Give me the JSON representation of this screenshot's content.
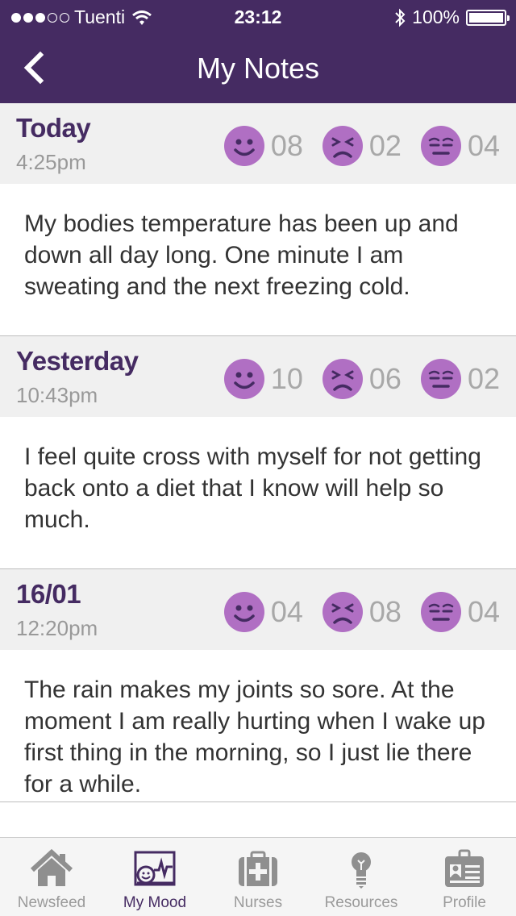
{
  "status": {
    "carrier": "Tuenti",
    "time": "23:12",
    "battery": "100%",
    "battery_level": 1.0
  },
  "nav": {
    "title": "My Notes",
    "back_icon": "chevron-left-icon"
  },
  "notes": [
    {
      "day": "Today",
      "time": "4:25pm",
      "moods": {
        "happy": "08",
        "upset": "02",
        "tired": "04"
      },
      "text": "My bodies temperature has been up and down all day long.  One minute I am sweating and the next freezing cold."
    },
    {
      "day": "Yesterday",
      "time": "10:43pm",
      "moods": {
        "happy": "10",
        "upset": "06",
        "tired": "02"
      },
      "text": "I feel quite cross with myself for not getting back onto a diet that I know will help so much."
    },
    {
      "day": "16/01",
      "time": "12:20pm",
      "moods": {
        "happy": "04",
        "upset": "08",
        "tired": "04"
      },
      "text": "The rain makes my joints so sore.  At the moment I am really hurting when I wake up first thing in the morning, so I just lie there for a while."
    }
  ],
  "tabs": [
    {
      "label": "Newsfeed",
      "icon": "house-icon",
      "active": false
    },
    {
      "label": "My Mood",
      "icon": "mood-chart-icon",
      "active": true
    },
    {
      "label": "Nurses",
      "icon": "medical-kit-icon",
      "active": false
    },
    {
      "label": "Resources",
      "icon": "lightbulb-icon",
      "active": false
    },
    {
      "label": "Profile",
      "icon": "id-card-icon",
      "active": false
    }
  ],
  "colors": {
    "brand": "#452b62",
    "mood_face": "#b06fc3",
    "inactive": "#9a9a9a"
  }
}
